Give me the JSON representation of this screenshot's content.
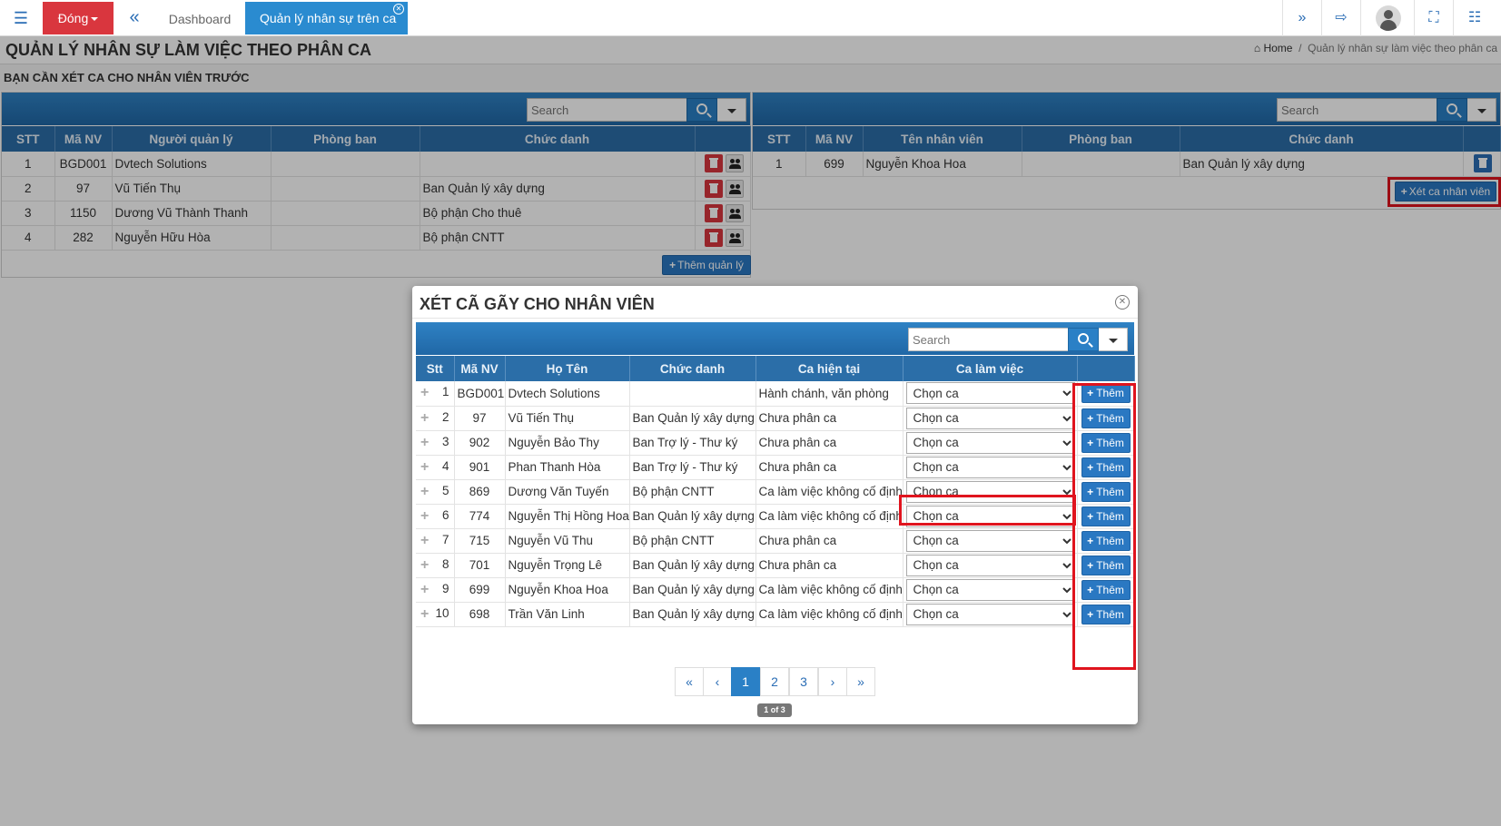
{
  "topbar": {
    "close_label": "Đóng",
    "tabs": [
      "Dashboard",
      "Quản lý nhân sự trên ca"
    ]
  },
  "page": {
    "title": "QUẢN LÝ NHÂN SỰ LÀM VIỆC THEO PHÂN CA",
    "breadcrumb": [
      "Home",
      "Quản lý nhân sự làm việc theo phân ca"
    ],
    "subtitle": "BẠN CẦN XÉT CA CHO NHÂN VIÊN TRƯỚC"
  },
  "search_placeholder": "Search",
  "left_table": {
    "headers": [
      "STT",
      "Mã NV",
      "Người quản lý",
      "Phòng ban",
      "Chức danh"
    ],
    "rows": [
      {
        "stt": "1",
        "ma": "BGD001",
        "name": "Dvtech Solutions",
        "dept": "",
        "title": ""
      },
      {
        "stt": "2",
        "ma": "97",
        "name": "Vũ Tiến Thụ",
        "dept": "",
        "title": "Ban Quản lý xây dựng"
      },
      {
        "stt": "3",
        "ma": "1150",
        "name": "Dương Vũ Thành Thanh",
        "dept": "",
        "title": "Bộ phận Cho thuê"
      },
      {
        "stt": "4",
        "ma": "282",
        "name": "Nguyễn Hữu Hòa",
        "dept": "",
        "title": "Bộ phận CNTT"
      }
    ],
    "add_button": "Thêm quản lý"
  },
  "right_table": {
    "headers": [
      "STT",
      "Mã NV",
      "Tên nhân viên",
      "Phòng ban",
      "Chức danh"
    ],
    "rows": [
      {
        "stt": "1",
        "ma": "699",
        "name": "Nguyễn Khoa Hoa",
        "dept": "",
        "title": "Ban Quản lý xây dựng"
      }
    ],
    "action_button": "Xét ca nhân viên"
  },
  "modal": {
    "title": "XÉT CÃ GÃY CHO NHÂN VIÊN",
    "headers": [
      "Stt",
      "Mã NV",
      "Họ Tên",
      "Chức danh",
      "Ca hiện tại",
      "Ca làm việc"
    ],
    "select_placeholder": "Chọn ca",
    "add_label": "Thêm",
    "rows": [
      {
        "stt": "1",
        "ma": "BGD001",
        "name": "Dvtech Solutions",
        "title": "",
        "current": "Hành chánh, văn phòng"
      },
      {
        "stt": "2",
        "ma": "97",
        "name": "Vũ Tiến Thụ",
        "title": "Ban Quản lý xây dựng",
        "current": "Chưa phân ca"
      },
      {
        "stt": "3",
        "ma": "902",
        "name": "Nguyễn Bảo Thy",
        "title": "Ban Trợ lý - Thư ký",
        "current": "Chưa phân ca"
      },
      {
        "stt": "4",
        "ma": "901",
        "name": "Phan Thanh Hòa",
        "title": "Ban Trợ lý - Thư ký",
        "current": "Chưa phân ca"
      },
      {
        "stt": "5",
        "ma": "869",
        "name": "Dương Văn Tuyến",
        "title": "Bộ phận CNTT",
        "current": "Ca làm việc không cố định"
      },
      {
        "stt": "6",
        "ma": "774",
        "name": "Nguyễn Thị Hồng Hoa",
        "title": "Ban Quản lý xây dựng",
        "current": "Ca làm việc không cố định"
      },
      {
        "stt": "7",
        "ma": "715",
        "name": "Nguyễn Vũ Thu",
        "title": "Bộ phận CNTT",
        "current": "Chưa phân ca"
      },
      {
        "stt": "8",
        "ma": "701",
        "name": "Nguyễn Trọng Lê",
        "title": "Ban Quản lý xây dựng",
        "current": "Chưa phân ca"
      },
      {
        "stt": "9",
        "ma": "699",
        "name": "Nguyễn Khoa Hoa",
        "title": "Ban Quản lý xây dựng",
        "current": "Ca làm việc không cố định"
      },
      {
        "stt": "10",
        "ma": "698",
        "name": "Trần Văn Linh",
        "title": "Ban Quản lý xây dựng",
        "current": "Ca làm việc không cố định"
      }
    ],
    "pagination": {
      "first": "«",
      "prev": "‹",
      "pages": [
        "1",
        "2",
        "3"
      ],
      "current": "1",
      "next": "›",
      "last": "»",
      "info": "1 of 3"
    }
  },
  "colors": {
    "header_blue": "#2b6ea8",
    "accent_blue": "#2a80c6",
    "close_red": "#d9363e",
    "highlight_red": "#e0141e"
  }
}
